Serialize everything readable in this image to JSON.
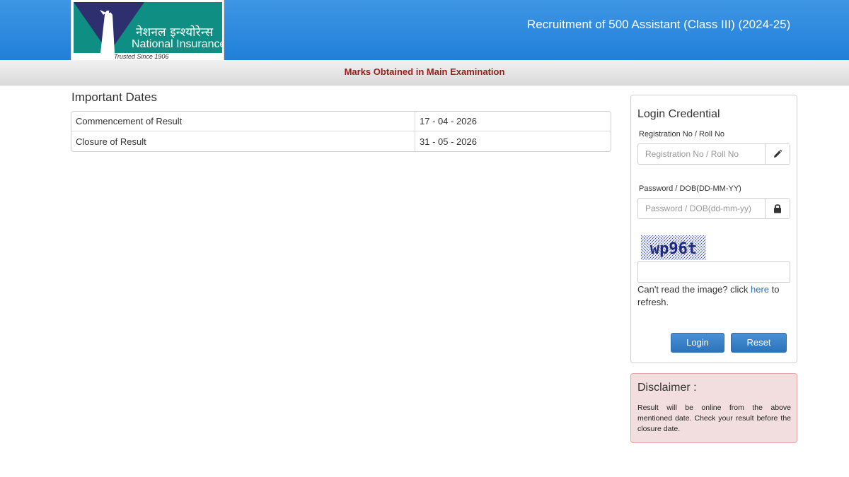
{
  "header": {
    "logo": {
      "hindi_name": "नेशनल इन्श्योरेन्स",
      "english_name": "National Insurance",
      "tagline": "Trusted Since 1906"
    },
    "title": "Recruitment of 500 Assistant (Class III) (2024-25)"
  },
  "subbar": {
    "text": "Marks Obtained in Main Examination"
  },
  "important_dates": {
    "title": "Important Dates",
    "rows": [
      {
        "label": "Commencement of Result",
        "value": "17 - 04 - 2026"
      },
      {
        "label": "Closure of Result",
        "value": "31 - 05 - 2026"
      }
    ]
  },
  "login": {
    "title": "Login Credential",
    "registration": {
      "label": "Registration No / Roll No",
      "placeholder": "Registration No / Roll No",
      "value": "",
      "icon": "pencil-icon"
    },
    "password": {
      "label": "Password / DOB(DD-MM-YY)",
      "placeholder": "Password / DOB(dd-mm-yy)",
      "value": "",
      "icon": "lock-icon"
    },
    "captcha": {
      "text": "wp96t",
      "value": ""
    },
    "refresh": {
      "prefix": "Can't read the image? click ",
      "link": "here",
      "suffix": " to refresh."
    },
    "login_button": "Login",
    "reset_button": "Reset"
  },
  "disclaimer": {
    "title": "Disclaimer :",
    "body": "Result will be online from the above mentioned date. Check your result before the closure date."
  },
  "colors": {
    "header_blue": "#1f7fd8",
    "logo_teal": "#0f8f84",
    "logo_navy": "#2e2f6e",
    "subbar_text": "#9b1c1c",
    "button_blue": "#2b73bb",
    "link_blue": "#2a6fb5",
    "disclaimer_bg": "#f2dede",
    "disclaimer_border": "#e4a6a6"
  }
}
